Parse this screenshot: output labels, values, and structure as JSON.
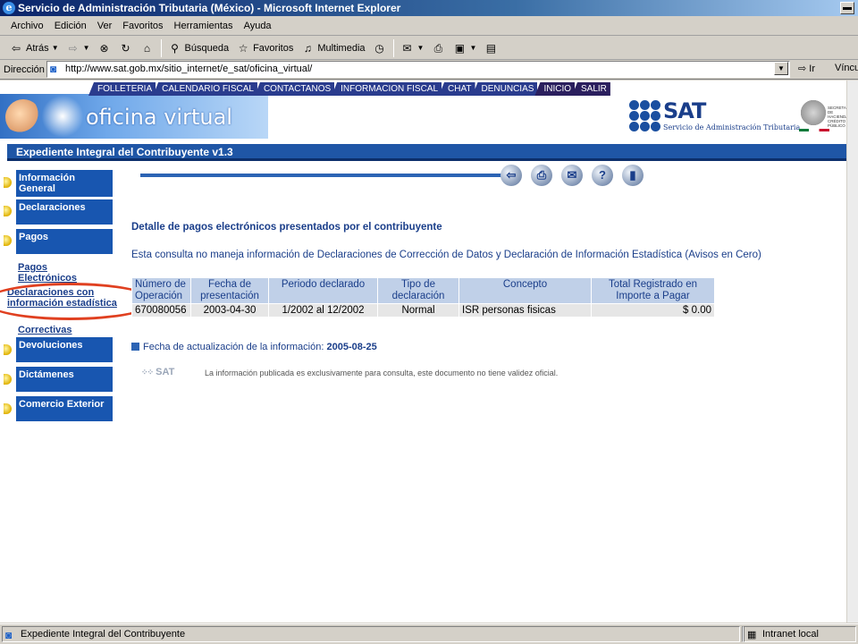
{
  "window": {
    "title": "Servicio de Administración Tributaria (México) - Microsoft Internet Explorer"
  },
  "menubar": [
    "Archivo",
    "Edición",
    "Ver",
    "Favoritos",
    "Herramientas",
    "Ayuda"
  ],
  "toolbar": {
    "back": "Atrás",
    "search": "Búsqueda",
    "favorites": "Favoritos",
    "media": "Multimedia"
  },
  "address": {
    "label": "Dirección",
    "url": "http://www.sat.gob.mx/sitio_internet/e_sat/oficina_virtual/",
    "go": "Ir",
    "links": "Víncu"
  },
  "topnav": [
    "FOLLETERIA",
    "CALENDARIO FISCAL",
    "CONTACTANOS",
    "INFORMACION FISCAL",
    "CHAT",
    "DENUNCIAS",
    "INICIO",
    "SALIR"
  ],
  "banner": {
    "text": "oficina virtual"
  },
  "sat": {
    "logo": "SAT",
    "subtitle": "Servicio de Administración Tributaria",
    "ministry": "SECRETARÍA DE HACIENDA Y CRÉDITO PÚBLICO"
  },
  "expediente": "Expediente Integral del Contribuyente v1.3",
  "leftmenu": {
    "info_general": "Información General",
    "declaraciones": "Declaraciones",
    "pagos": "Pagos",
    "pagos_electronicos": "Pagos Electrónicos",
    "decl_info_estadistica": "Declaraciones con información estadística",
    "correctivas": "Correctivas",
    "devoluciones": "Devoluciones",
    "dictamenes": "Dictámenes",
    "comercio_exterior": "Comercio Exterior"
  },
  "content": {
    "heading": "Detalle de pagos electrónicos presentados por el contribuyente",
    "note": "Esta consulta no maneja información de Declaraciones de Corrección de Datos y Declaración de Información Estadística (Avisos en Cero)",
    "table": {
      "headers": [
        "Número de Operación",
        "Fecha de presentación",
        "Periodo declarado",
        "Tipo de declaración",
        "Concepto",
        "Total Registrado en Importe a Pagar"
      ],
      "rows": [
        [
          "670080056",
          "2003-04-30",
          "1/2002 al 12/2002",
          "Normal",
          "ISR personas fisicas",
          "$ 0.00"
        ]
      ]
    },
    "update_label": "Fecha de actualización de la información:",
    "update_date": "2005-08-25",
    "footer_logo": "SAT",
    "disclaimer": "La información publicada es exclusivamente para consulta, este documento no tiene validez oficial."
  },
  "status": {
    "text": "Expediente Integral del Contribuyente",
    "zone": "Intranet local"
  },
  "colors": {
    "nav_blue": "#1856b0",
    "header_blue": "#1f56a6",
    "text_blue": "#1a3e8a",
    "annotation_red": "#e04020"
  }
}
